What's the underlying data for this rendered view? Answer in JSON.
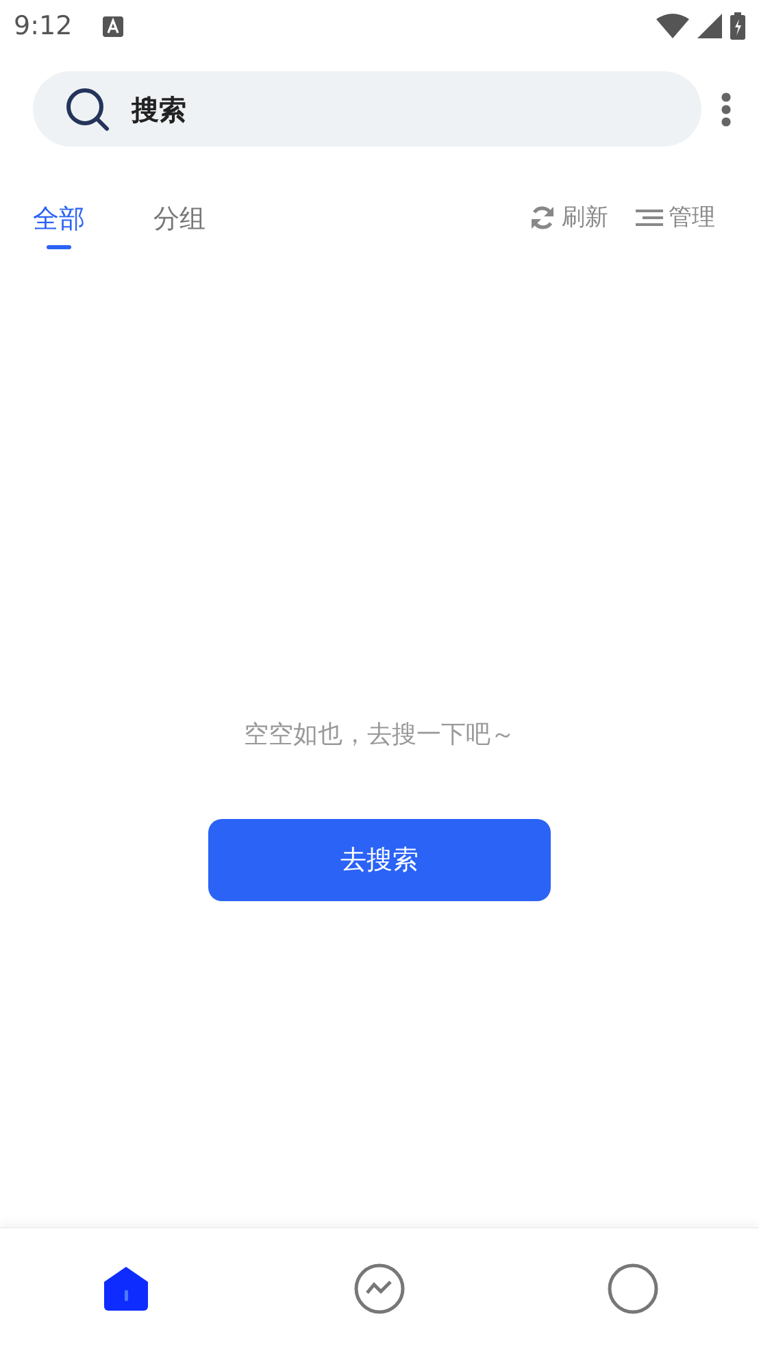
{
  "status_bar": {
    "time": "9:12"
  },
  "search": {
    "placeholder": "搜索"
  },
  "tabs": [
    {
      "label": "全部",
      "selected": true
    },
    {
      "label": "分组",
      "selected": false
    }
  ],
  "actions": [
    {
      "kind": "refresh",
      "label": "刷新"
    },
    {
      "kind": "manage",
      "label": "管理"
    }
  ],
  "empty_state": {
    "message": "空空如也，去搜一下吧～",
    "button": "去搜索"
  },
  "bottom_nav": [
    {
      "kind": "home",
      "selected": true
    },
    {
      "kind": "trend",
      "selected": false
    },
    {
      "kind": "profile",
      "selected": false
    }
  ]
}
